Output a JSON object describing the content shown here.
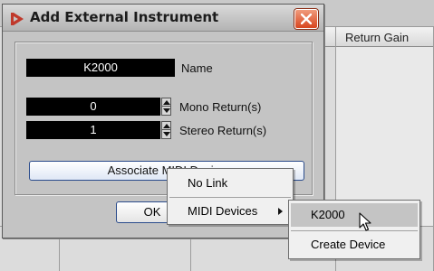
{
  "dialog": {
    "title": "Add External Instrument",
    "fields": {
      "name_value": "K2000",
      "name_label": "Name",
      "mono_value": "0",
      "mono_label": "Mono Return(s)",
      "stereo_value": "1",
      "stereo_label": "Stereo Return(s)"
    },
    "associate_button": "Associate MIDI Device",
    "ok_button": "OK"
  },
  "background": {
    "column_header": "Return Gain"
  },
  "context_menu": {
    "items": [
      "No Link",
      "MIDI Devices"
    ]
  },
  "submenu": {
    "items": [
      "K2000",
      "Create Device"
    ],
    "highlighted": "K2000"
  },
  "colors": {
    "field_bg": "#000000",
    "field_text": "#ffffff",
    "close_button": "#d8451f",
    "app_icon": "#c0392b",
    "button_border": "#2b4c8c"
  },
  "icons": {
    "app": "cubase-red-logo-icon",
    "close": "close-x-icon",
    "cursor": "mouse-pointer-icon"
  }
}
